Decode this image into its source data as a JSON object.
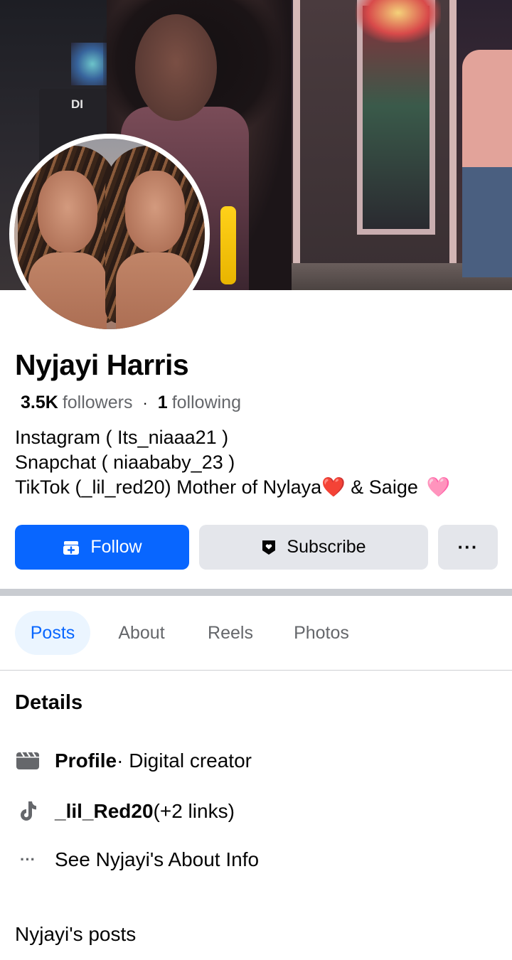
{
  "profile": {
    "name": "Nyjayi Harris",
    "followers_count": "3.5K",
    "followers_label": "followers",
    "separator": "·",
    "following_count": "1",
    "following_label": "following",
    "bio_line1": "Instagram ( Its_niaaa21 )",
    "bio_line2": "Snapchat ( niaababy_23 )",
    "bio_line3_text": "TikTok (_lil_red20) Mother of Nylaya",
    "bio_line3_emoji": "❤️",
    "bio_line3_end": " & Saige",
    "bio_line3_emoji2": "🩷"
  },
  "cover": {
    "sign_text": "DI"
  },
  "actions": {
    "follow_label": "Follow",
    "subscribe_label": "Subscribe",
    "more_label": "···"
  },
  "tabs": [
    {
      "label": "Posts",
      "active": true
    },
    {
      "label": "About",
      "active": false
    },
    {
      "label": "Reels",
      "active": false
    },
    {
      "label": "Photos",
      "active": false
    }
  ],
  "details": {
    "title": "Details",
    "profile_label": "Profile",
    "profile_category": " · Digital creator",
    "tiktok_handle": "_lil_Red20",
    "tiktok_more": " (+2 links)",
    "about_info": "See Nyjayi's About Info",
    "more_icon": "···"
  },
  "posts_heading": "Nyjayi's posts",
  "colors": {
    "accent": "#0866ff",
    "tab_active_bg": "#ebf5ff",
    "button_gray": "#e4e6eb",
    "secondary_text": "#65676b"
  },
  "icons": {
    "follow": "add-friend-icon",
    "subscribe": "subscribe-badge-icon",
    "profile": "clapperboard-icon",
    "tiktok": "tiktok-icon",
    "about": "more-dots-icon"
  }
}
